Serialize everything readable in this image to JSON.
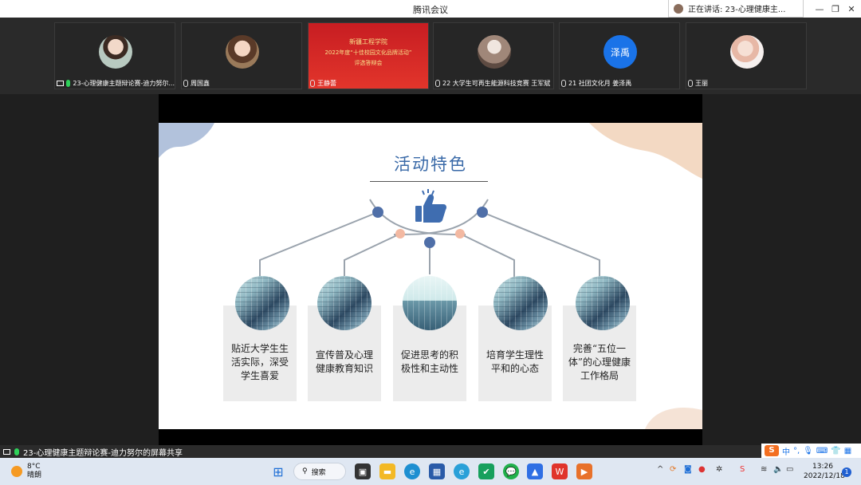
{
  "window": {
    "title": "腾讯会议",
    "speaking": "正在讲话: 23-心理健康主..."
  },
  "participants": [
    {
      "name": "23-心理健康主题辩论赛-迪力努尔...",
      "mic": "on",
      "sharing": true
    },
    {
      "name": "周国鑫",
      "mic": "off"
    },
    {
      "name": "王静蕾",
      "mic": "off",
      "poster_lines": [
        "新疆工程学院",
        "2022年度“十佳校园文化品牌活动”",
        "评选答辩会"
      ]
    },
    {
      "name": "22 大学生可再生能源科技竞赛 王军斌",
      "mic": "off"
    },
    {
      "name": "21 社团文化月 姜泽禹",
      "mic": "off",
      "avatar_text": "泽禹"
    },
    {
      "name": "王丽",
      "mic": "off"
    }
  ],
  "slide": {
    "title": "活动特色",
    "cards": [
      "贴近大学生生活实际，深受学生喜爱",
      "宣传普及心理健康教育知识",
      "促进思考的积极性和主动性",
      "培育学生理性平和的心态",
      "完善“五位一体”的心理健康工作格局"
    ]
  },
  "share_bar": {
    "text": "23-心理健康主题辩论赛-迪力努尔的屏幕共享"
  },
  "ime": {
    "lang": "中"
  },
  "taskbar": {
    "weather_temp": "8°C",
    "weather_desc": "晴朗",
    "search_label": "搜索",
    "time": "13:26",
    "date": "2022/12/18",
    "notifications": "1"
  }
}
